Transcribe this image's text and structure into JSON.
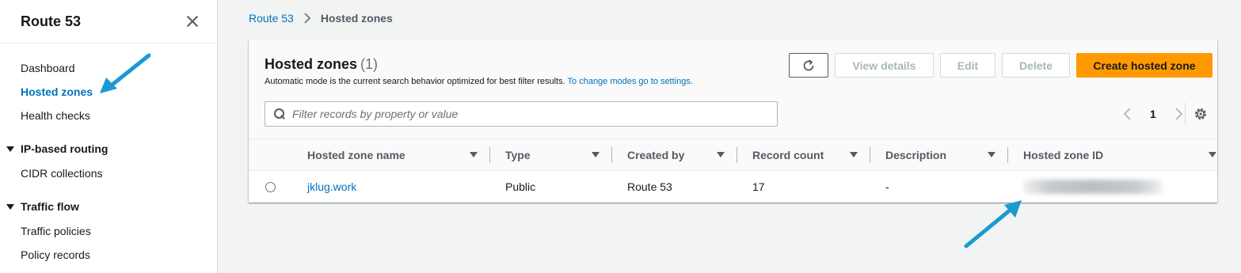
{
  "sidebar": {
    "title": "Route 53",
    "items": [
      {
        "label": "Dashboard"
      },
      {
        "label": "Hosted zones"
      },
      {
        "label": "Health checks"
      }
    ],
    "sections": [
      {
        "label": "IP-based routing",
        "items": [
          {
            "label": "CIDR collections"
          }
        ]
      },
      {
        "label": "Traffic flow",
        "items": [
          {
            "label": "Traffic policies"
          },
          {
            "label": "Policy records"
          }
        ]
      }
    ]
  },
  "breadcrumb": {
    "root": "Route 53",
    "current": "Hosted zones"
  },
  "panel": {
    "title": "Hosted zones",
    "count": "(1)",
    "description": "Automatic mode is the current search behavior optimized for best filter results.",
    "description_link": "To change modes go to settings.",
    "buttons": {
      "view_details": "View details",
      "edit": "Edit",
      "delete": "Delete",
      "create": "Create hosted zone"
    },
    "search": {
      "placeholder": "Filter records by property or value"
    },
    "pagination": {
      "current_page": "1"
    }
  },
  "table": {
    "columns": [
      "Hosted zone name",
      "Type",
      "Created by",
      "Record count",
      "Description",
      "Hosted zone ID"
    ],
    "rows": [
      {
        "name": "jklug.work",
        "type": "Public",
        "created_by": "Route 53",
        "record_count": "17",
        "description": "-"
      }
    ]
  },
  "colors": {
    "accent": "#0073bb",
    "primary_button": "#ff9900",
    "annotation_arrow": "#1a9bd0"
  }
}
